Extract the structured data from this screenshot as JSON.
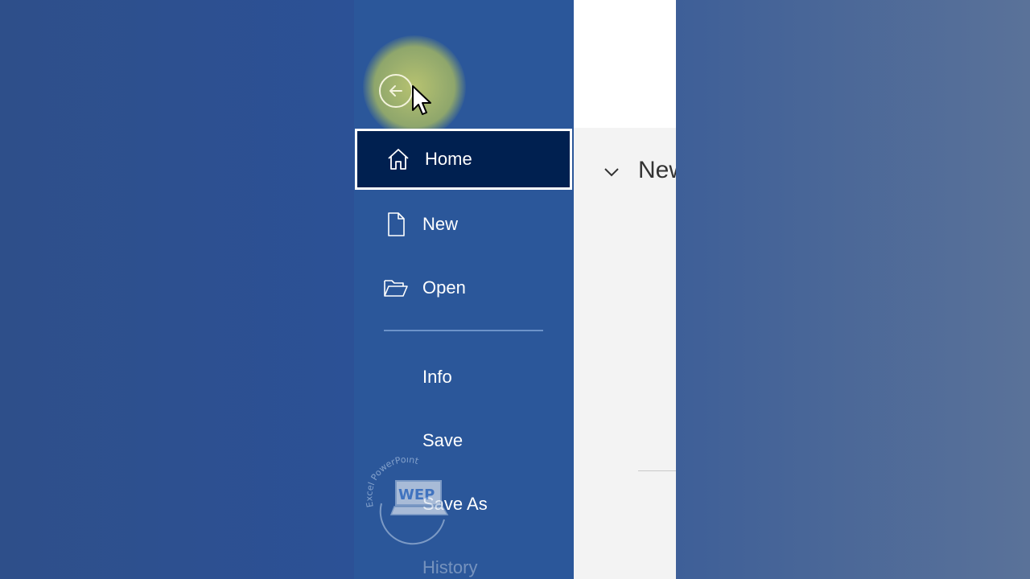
{
  "backstage": {
    "back_icon": "arrow-left-circle-icon",
    "items": [
      {
        "label": "Home",
        "icon": "home-icon",
        "selected": true
      },
      {
        "label": "New",
        "icon": "new-document-icon"
      },
      {
        "label": "Open",
        "icon": "open-folder-icon"
      },
      {
        "label": "Info"
      },
      {
        "label": "Save"
      },
      {
        "label": "Save As"
      },
      {
        "label": "History"
      }
    ]
  },
  "main": {
    "section_title": "New",
    "chevron_icon": "chevron-down-icon"
  },
  "watermark": {
    "arc_text": "Excel PowerPoint",
    "logo_text": "WEP"
  },
  "colors": {
    "backstage": "#2b579a",
    "selected": "#002050",
    "halo": "#bec86e"
  }
}
